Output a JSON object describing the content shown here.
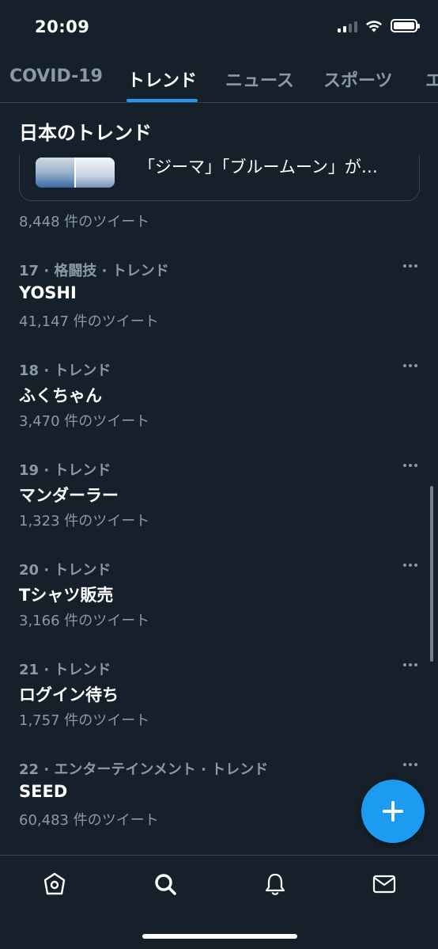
{
  "status_bar": {
    "time": "20:09"
  },
  "tabs": [
    {
      "label": "COVID-19"
    },
    {
      "label": "トレンド"
    },
    {
      "label": "ニュース"
    },
    {
      "label": "スポーツ"
    },
    {
      "label": "エ"
    }
  ],
  "section": {
    "title": "日本のトレンド"
  },
  "news_card": {
    "text": "「ジーマ」「ブルームーン」が…"
  },
  "top_tweet_count": "8,448 件のツイート",
  "trends": [
    {
      "meta": "17 · 格闘技 · トレンド",
      "name": "YOSHI",
      "count": "41,147 件のツイート"
    },
    {
      "meta": "18 · トレンド",
      "name": "ふくちゃん",
      "count": "3,470 件のツイート"
    },
    {
      "meta": "19 · トレンド",
      "name": "マンダーラー",
      "count": "1,323 件のツイート"
    },
    {
      "meta": "20 · トレンド",
      "name": "Tシャツ販売",
      "count": "3,166 件のツイート"
    },
    {
      "meta": "21 · トレンド",
      "name": "ログイン待ち",
      "count": "1,757 件のツイート"
    },
    {
      "meta": "22 · エンターテインメント · トレンド",
      "name": "SEED",
      "count": "60,483 件のツイート"
    }
  ],
  "bottom_nav": [
    {
      "icon": "home-icon"
    },
    {
      "icon": "search-icon"
    },
    {
      "icon": "bell-icon"
    },
    {
      "icon": "mail-icon"
    }
  ],
  "colors": {
    "accent": "#1d9bf0",
    "background": "#15202b",
    "secondary_text": "#8b98a5",
    "border": "#38444d"
  }
}
